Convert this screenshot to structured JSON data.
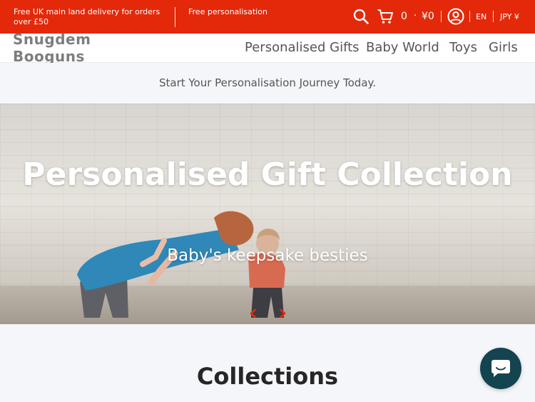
{
  "topbar": {
    "promo_left": "Free UK main land delivery for orders over £50",
    "promo_right": "Free personalisation",
    "cart_count": "0",
    "cart_separator": "·",
    "cart_total": "¥0",
    "language": "EN",
    "currency": "JPY ¥",
    "colors": {
      "background": "#e3290a",
      "text": "#ffffff"
    },
    "icons": [
      "search-icon",
      "cart-icon",
      "account-icon"
    ]
  },
  "header": {
    "logo_text": "Snugdem Booguns",
    "nav": [
      "Personalised Gifts",
      "Baby World",
      "Toys",
      "Girls"
    ]
  },
  "announcement": {
    "text": "Start Your Personalisation Journey Today."
  },
  "hero": {
    "title": "Personalised Gift Collection",
    "subtitle": "Baby's keepsake besties",
    "prev_icon": "chevron-left-icon",
    "next_icon": "chevron-right-icon"
  },
  "collections": {
    "title": "Collections"
  },
  "chat": {
    "icon": "chat-icon",
    "color": "#14444f"
  }
}
